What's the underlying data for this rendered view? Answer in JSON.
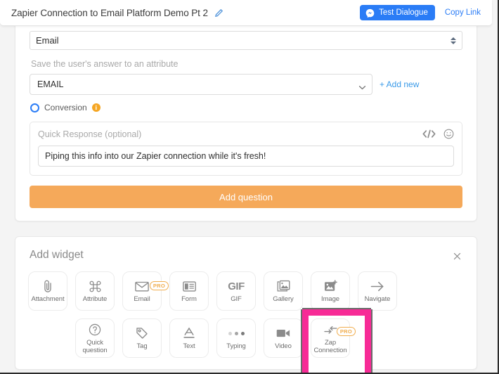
{
  "header": {
    "title": "Zapier Connection to Email Platform Demo Pt 2",
    "edit_icon": "pencil-icon",
    "test_dialogue_label": "Test Dialogue",
    "messenger_icon": "messenger-icon",
    "copy_link_label": "Copy Link",
    "accent_blue": "#2a7cf6"
  },
  "question_card": {
    "type_select_value": "Email",
    "attribute_section_label": "Save the user's answer to an attribute",
    "attribute_select_value": "EMAIL",
    "add_new_label": "+ Add new",
    "conversion_label": "Conversion",
    "info_icon": "info-icon",
    "quick_response": {
      "title": "Quick Response (optional)",
      "code_icon": "code-icon",
      "emoji_icon": "smiley-icon",
      "input_value": "Piping this info into our Zapier connection while it's fresh!"
    },
    "add_question_label": "Add question",
    "add_question_color": "#f5a95a"
  },
  "add_widget": {
    "title": "Add widget",
    "close_icon": "close-icon",
    "highlight_color": "#f72b96",
    "pro_badge_label": "PRO",
    "row1": [
      {
        "label": "Attachment",
        "icon": "paperclip-icon",
        "pro": false
      },
      {
        "label": "Attribute",
        "icon": "command-icon",
        "pro": false
      },
      {
        "label": "Email",
        "icon": "envelope-icon",
        "pro": true
      },
      {
        "label": "Form",
        "icon": "form-icon",
        "pro": false
      },
      {
        "label": "GIF",
        "icon": "gif-icon",
        "pro": false
      },
      {
        "label": "Gallery",
        "icon": "gallery-icon",
        "pro": false
      },
      {
        "label": "Image",
        "icon": "image-icon",
        "pro": false
      },
      {
        "label": "Navigate",
        "icon": "arrow-right-icon",
        "pro": false
      }
    ],
    "row2": [
      {
        "label": "Quick question",
        "icon": "question-circle-icon",
        "pro": false
      },
      {
        "label": "Tag",
        "icon": "tag-icon",
        "pro": false
      },
      {
        "label": "Text",
        "icon": "text-icon",
        "pro": false
      },
      {
        "label": "Typing",
        "icon": "typing-dots-icon",
        "pro": false
      },
      {
        "label": "Video",
        "icon": "video-camera-icon",
        "pro": false
      },
      {
        "label": "Zap Connection",
        "icon": "zap-connection-icon",
        "pro": true,
        "highlighted": true
      }
    ]
  }
}
